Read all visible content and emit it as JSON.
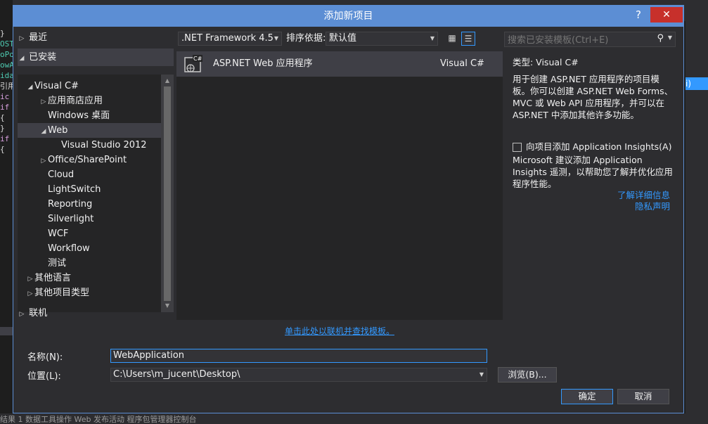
{
  "dialog": {
    "title": "添加新项目",
    "help_label": "?",
    "close_label": "✕"
  },
  "tree": {
    "recent": "最近",
    "installed": "已安装",
    "online": "联机",
    "items": [
      {
        "label": "Visual C#",
        "arrow": "◢"
      },
      {
        "label": "应用商店应用",
        "arrow": "▷"
      },
      {
        "label": "Windows 桌面",
        "arrow": ""
      },
      {
        "label": "Web",
        "arrow": "◢"
      },
      {
        "label": "Visual Studio 2012",
        "arrow": ""
      },
      {
        "label": "Office/SharePoint",
        "arrow": "▷"
      },
      {
        "label": "Cloud",
        "arrow": ""
      },
      {
        "label": "LightSwitch",
        "arrow": ""
      },
      {
        "label": "Reporting",
        "arrow": ""
      },
      {
        "label": "Silverlight",
        "arrow": ""
      },
      {
        "label": "WCF",
        "arrow": ""
      },
      {
        "label": "Workflow",
        "arrow": ""
      },
      {
        "label": "测试",
        "arrow": ""
      },
      {
        "label": "其他语言",
        "arrow": "▷"
      },
      {
        "label": "其他项目类型",
        "arrow": "▷"
      }
    ]
  },
  "toolbar": {
    "framework": ".NET Framework 4.5",
    "sort_label": "排序依据:",
    "sort_value": "默认值"
  },
  "templates": [
    {
      "name": "ASP.NET Web 应用程序",
      "language": "Visual C#",
      "badge": "C#"
    }
  ],
  "online_link": "单击此处以联机并查找模板。",
  "search": {
    "placeholder": "搜索已安装模板(Ctrl+E)"
  },
  "details": {
    "type": "类型:  Visual C#",
    "description": "用于创建 ASP.NET 应用程序的项目模板。你可以创建 ASP.NET Web Forms、MVC 或 Web API 应用程序，并可以在 ASP.NET 中添加其他许多功能。",
    "insights_checkbox": "向项目添加 Application Insights(A)",
    "insights_note": "Microsoft 建议添加 Application Insights 遥测，以帮助您了解并优化应用程序性能。",
    "learn_more": "了解详细信息",
    "privacy": "隐私声明"
  },
  "form": {
    "name_label": "名称(N):",
    "name_value": "WebApplication",
    "location_label": "位置(L):",
    "location_value": "C:\\Users\\m_jucent\\Desktop\\",
    "browse_label": "浏览(B)...",
    "ok_label": "确定",
    "cancel_label": "取消"
  },
  "background": {
    "code_lines": [
      "}",
      "",
      "",
      "OST",
      "oPo",
      "owA",
      "ida",
      "引用",
      "ic",
      "",
      "if",
      "{",
      "",
      "}",
      "",
      "if",
      "{"
    ],
    "right_selected": "i)",
    "right_bottom": "理器",
    "status_bar": "结果 1    数据工具操作    Web 发布活动    程序包管理器控制台"
  }
}
